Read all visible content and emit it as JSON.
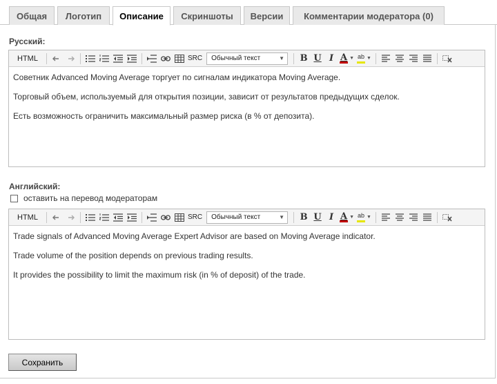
{
  "tabs": [
    {
      "label": "Общая"
    },
    {
      "label": "Логотип"
    },
    {
      "label": "Описание"
    },
    {
      "label": "Скриншоты"
    },
    {
      "label": "Версии"
    },
    {
      "label": "Комментарии модератора (0)"
    }
  ],
  "active_tab": "Описание",
  "toolbar": {
    "html_label": "HTML",
    "src_label": "SRC",
    "format_value": "Обычный текст",
    "bold_label": "B",
    "underline_label": "U",
    "italic_label": "I",
    "font_color_label": "A",
    "highlight_label": "ab"
  },
  "russian": {
    "label": "Русский:",
    "paragraphs": [
      "Советник Advanced Moving Average торгует по сигналам индикатора Moving Average.",
      "Торговый объем, используемый для открытия позиции, зависит от результатов предыдущих сделок.",
      "Есть возможность ограничить максимальный размер риска (в % от депозита)."
    ]
  },
  "english": {
    "label": "Английский:",
    "checkbox_label": "оставить на перевод модераторам",
    "checkbox_checked": false,
    "paragraphs": [
      "Trade signals of Advanced Moving Average Expert Advisor are based on Moving Average indicator.",
      "Trade volume of the position depends on previous trading results.",
      "It provides the possibility to limit the maximum risk (in % of deposit) of the trade."
    ]
  },
  "save_button": "Сохранить",
  "colors": {
    "font_color_bar": "#c00000",
    "highlight_bar": "#e6e600"
  }
}
